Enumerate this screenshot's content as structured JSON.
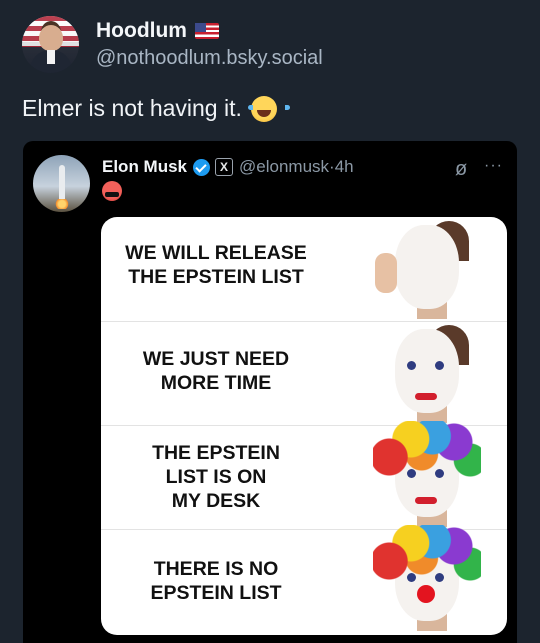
{
  "post": {
    "display_name": "Hoodlum",
    "flag_icon": "us-flag-icon",
    "handle": "@nothoodlum.bsky.social",
    "text": "Elmer is not having it.",
    "emoji": "laughing-tears-icon"
  },
  "embed": {
    "name": "Elon Musk",
    "handle": "@elonmusk",
    "separator": "·",
    "time": "4h",
    "reaction_emoji": "enraged-face-icon",
    "meme": {
      "panels": [
        {
          "text": "WE WILL RELEASE\nTHE EPSTEIN LIST",
          "stage": "white-face-paint"
        },
        {
          "text": "WE JUST NEED\nMORE TIME",
          "stage": "clown-makeup"
        },
        {
          "text": "THE EPSTEIN\nLIST IS ON\nMY DESK",
          "stage": "clown-wig"
        },
        {
          "text": "THERE IS NO\nEPSTEIN LIST",
          "stage": "full-clown-nose"
        }
      ]
    }
  },
  "colors": {
    "background": "#1c242e",
    "embed_background": "#000000",
    "verified_blue": "#1d9bf0",
    "muted_text": "#8b98a5"
  }
}
